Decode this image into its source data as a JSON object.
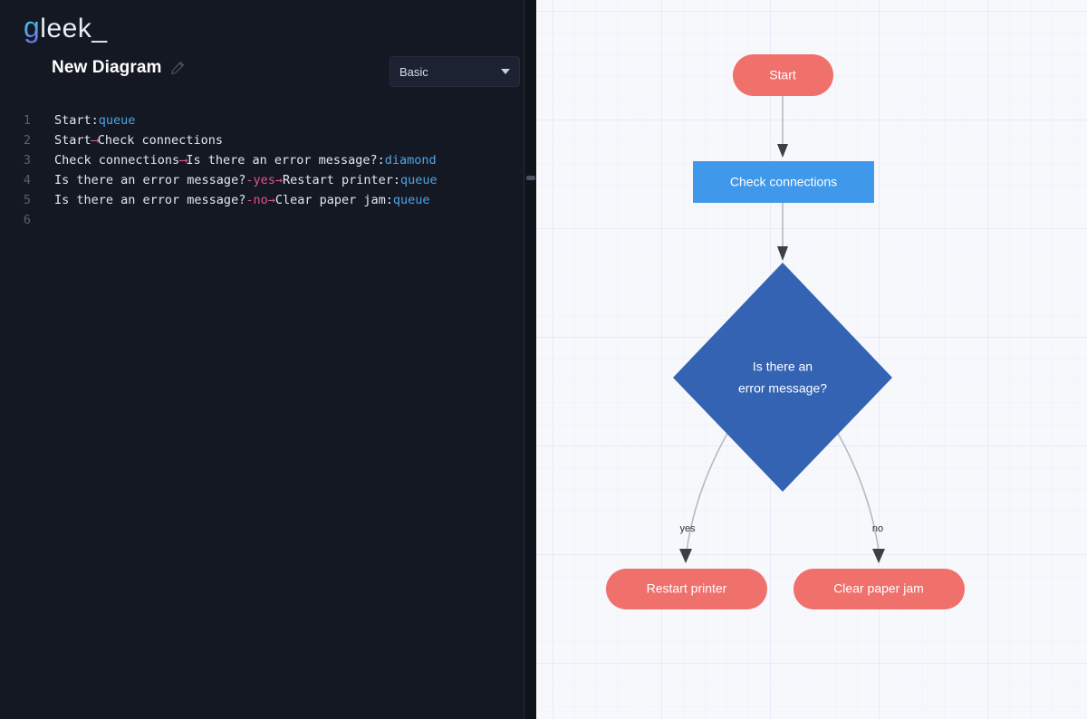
{
  "brand": {
    "logo_g": "g",
    "logo_rest": "leek_"
  },
  "header": {
    "diagram_title": "New Diagram",
    "edit_icon": "pencil-icon",
    "style_select": {
      "value": "Basic",
      "caret_icon": "chevron-down-icon",
      "options": [
        "Basic"
      ]
    }
  },
  "editor": {
    "line_numbers": [
      "1",
      "2",
      "3",
      "4",
      "5",
      "6"
    ],
    "lines": [
      {
        "n": "1",
        "parts": [
          {
            "t": "Start:",
            "cls": "tok-plain"
          },
          {
            "t": "queue",
            "cls": "tok-type"
          }
        ]
      },
      {
        "n": "2",
        "parts": [
          {
            "t": "Start",
            "cls": "tok-plain"
          },
          {
            "t": "⟶",
            "cls": "tok-arrow-long"
          },
          {
            "t": "Check connections",
            "cls": "tok-plain"
          }
        ]
      },
      {
        "n": "3",
        "parts": [
          {
            "t": "Check connections",
            "cls": "tok-plain"
          },
          {
            "t": "⟶",
            "cls": "tok-arrow-long"
          },
          {
            "t": "Is there an error message?:",
            "cls": "tok-plain"
          },
          {
            "t": "diamond",
            "cls": "tok-type"
          }
        ]
      },
      {
        "n": "4",
        "parts": [
          {
            "t": "Is there an error message?",
            "cls": "tok-plain"
          },
          {
            "t": "-yes",
            "cls": "tok-label"
          },
          {
            "t": "→",
            "cls": "tok-arrow"
          },
          {
            "t": "Restart printer:",
            "cls": "tok-plain"
          },
          {
            "t": "queue",
            "cls": "tok-type"
          }
        ]
      },
      {
        "n": "5",
        "parts": [
          {
            "t": "Is there an error message?",
            "cls": "tok-plain"
          },
          {
            "t": "-no",
            "cls": "tok-label"
          },
          {
            "t": "→",
            "cls": "tok-arrow"
          },
          {
            "t": "Clear paper jam:",
            "cls": "tok-plain"
          },
          {
            "t": "queue",
            "cls": "tok-type"
          }
        ]
      },
      {
        "n": "6",
        "parts": []
      }
    ]
  },
  "splitter": {
    "handle": "resize-handle"
  },
  "diagram": {
    "nodes": {
      "start": {
        "label": "Start",
        "shape": "queue",
        "color": "#f0706c"
      },
      "check": {
        "label": "Check connections",
        "shape": "rect",
        "color": "#3f98ea"
      },
      "decision": {
        "label_line1": "Is there an",
        "label_line2": "error message?",
        "shape": "diamond",
        "color": "#3463b4"
      },
      "restart": {
        "label": "Restart printer",
        "shape": "queue",
        "color": "#f0706c"
      },
      "clear": {
        "label": "Clear paper jam",
        "shape": "queue",
        "color": "#f0706c"
      }
    },
    "edge_labels": {
      "yes": "yes",
      "no": "no"
    }
  }
}
